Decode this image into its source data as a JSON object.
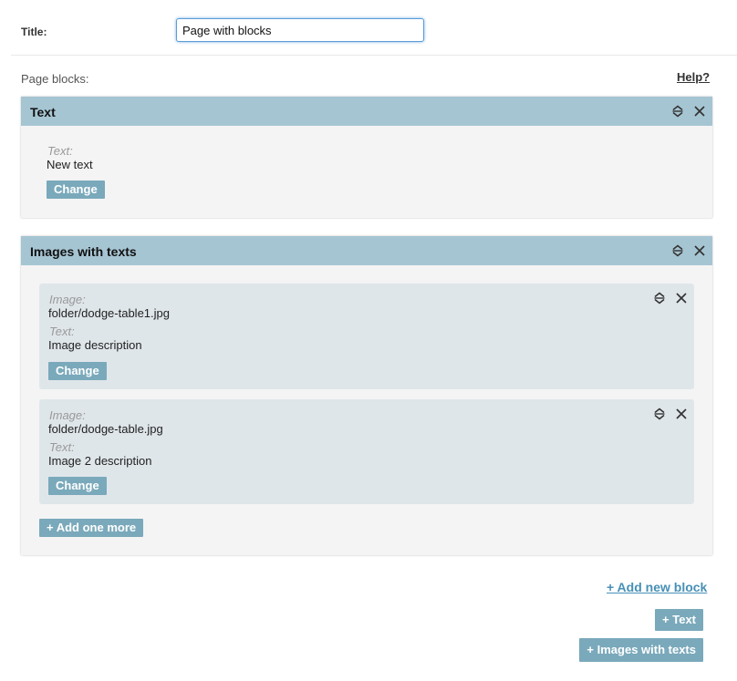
{
  "title_field": {
    "label": "Title:",
    "value": "Page with blocks"
  },
  "page_blocks_label": "Page blocks:",
  "help_link": "Help?",
  "text_block": {
    "title": "Text",
    "field_label": "Text:",
    "field_value": "New text",
    "change_label": "Change"
  },
  "images_block": {
    "title": "Images with texts",
    "items": [
      {
        "image_label": "Image:",
        "image_value": "folder/dodge-table1.jpg",
        "text_label": "Text:",
        "text_value": "Image description",
        "change_label": "Change"
      },
      {
        "image_label": "Image:",
        "image_value": "folder/dodge-table.jpg",
        "text_label": "Text:",
        "text_value": "Image 2 description",
        "change_label": "Change"
      }
    ],
    "add_more_label": "+ Add one more"
  },
  "add_new_block": {
    "link_label": "+ Add new block",
    "text_button": "+ Text",
    "images_button": "+ Images with texts"
  },
  "colors": {
    "header": "#a6c5d3",
    "button": "#7aa9bb",
    "link": "#4790b6",
    "sub_item_bg": "#dfe6ea",
    "block_bg": "#f4f4f4"
  },
  "icons": {
    "sort": "sort-icon",
    "close": "close-icon"
  }
}
